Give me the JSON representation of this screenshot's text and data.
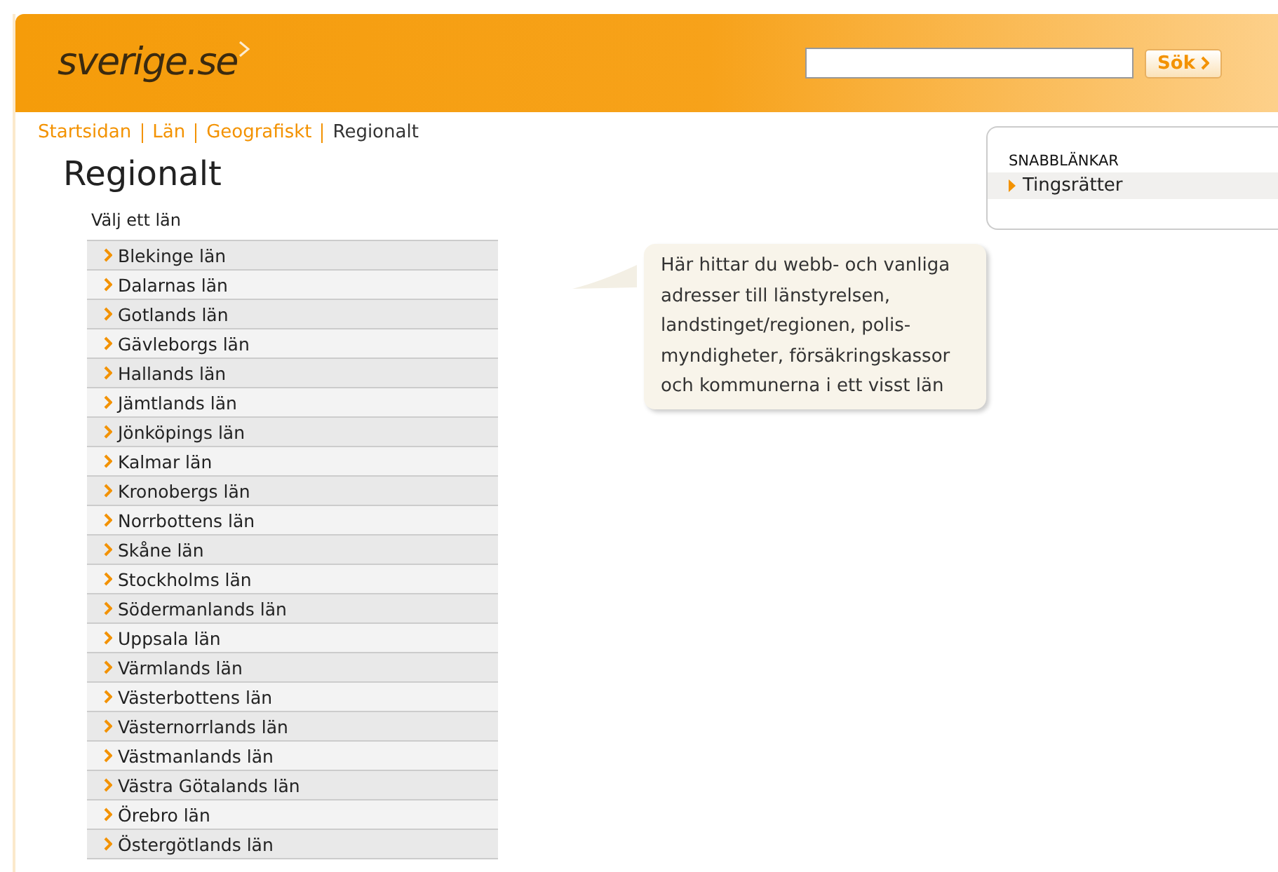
{
  "header": {
    "logo": "sverige.se",
    "search_button": "Sök"
  },
  "breadcrumbs": [
    {
      "label": "Startsidan",
      "current": false
    },
    {
      "label": "Län",
      "current": false
    },
    {
      "label": "Geografiskt",
      "current": false
    },
    {
      "label": "Regionalt",
      "current": true
    }
  ],
  "title": "Regionalt",
  "list_label": "Välj ett län",
  "counties": [
    "Blekinge län",
    "Dalarnas län",
    "Gotlands län",
    "Gävleborgs län",
    "Hallands län",
    "Jämtlands län",
    "Jönköpings län",
    "Kalmar län",
    "Kronobergs län",
    "Norrbottens län",
    "Skåne län",
    "Stockholms län",
    "Södermanlands län",
    "Uppsala län",
    "Värmlands län",
    "Västerbottens län",
    "Västernorrlands län",
    "Västmanlands län",
    "Västra Götalands län",
    "Örebro län",
    "Östergötlands län"
  ],
  "tooltip": "Här hittar du webb- och vanliga adresser till länstyrelsen, landstinget/regionen, polis-myndigheter, försäkringskassor och kommunerna i ett visst län",
  "quick_links": {
    "heading": "SNABBLÄNKAR",
    "items": [
      "Tingsrätter"
    ]
  }
}
